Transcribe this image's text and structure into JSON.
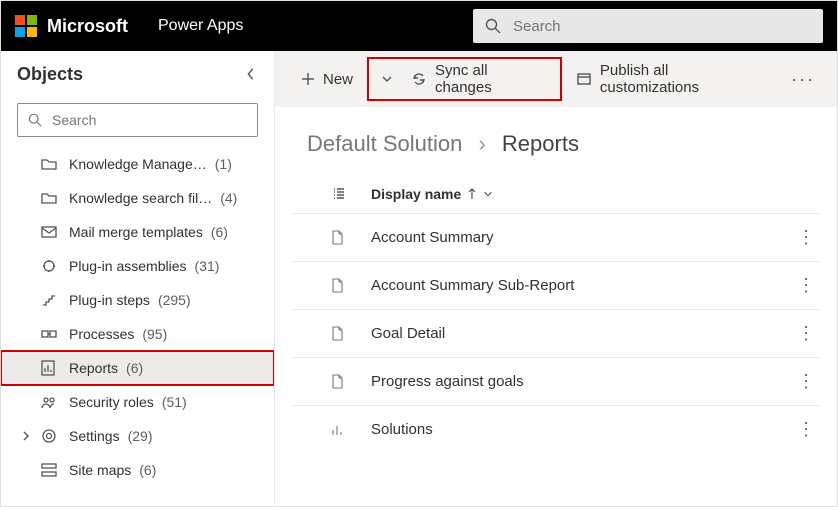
{
  "header": {
    "brand": "Microsoft",
    "app": "Power Apps",
    "search_placeholder": "Search"
  },
  "sidebar": {
    "title": "Objects",
    "search_placeholder": "Search",
    "items": [
      {
        "label": "Knowledge Manage…",
        "count": "(1)",
        "icon": "folder",
        "selected": false,
        "expandable": false
      },
      {
        "label": "Knowledge search fil…",
        "count": "(4)",
        "icon": "folder",
        "selected": false,
        "expandable": false
      },
      {
        "label": "Mail merge templates",
        "count": "(6)",
        "icon": "mail",
        "selected": false,
        "expandable": false
      },
      {
        "label": "Plug-in assemblies",
        "count": "(31)",
        "icon": "plugin",
        "selected": false,
        "expandable": false
      },
      {
        "label": "Plug-in steps",
        "count": "(295)",
        "icon": "steps",
        "selected": false,
        "expandable": false
      },
      {
        "label": "Processes",
        "count": "(95)",
        "icon": "process",
        "selected": false,
        "expandable": false
      },
      {
        "label": "Reports",
        "count": "(6)",
        "icon": "report",
        "selected": true,
        "expandable": false
      },
      {
        "label": "Security roles",
        "count": "(51)",
        "icon": "roles",
        "selected": false,
        "expandable": false
      },
      {
        "label": "Settings",
        "count": "(29)",
        "icon": "settings",
        "selected": false,
        "expandable": true
      },
      {
        "label": "Site maps",
        "count": "(6)",
        "icon": "sitemap",
        "selected": false,
        "expandable": false
      }
    ]
  },
  "commandbar": {
    "new_label": "New",
    "sync_label": "Sync all changes",
    "publish_label": "Publish all customizations"
  },
  "breadcrumb": {
    "root": "Default Solution",
    "current": "Reports"
  },
  "grid": {
    "header": "Display name",
    "rows": [
      {
        "name": "Account Summary",
        "icon": "doc"
      },
      {
        "name": "Account Summary Sub-Report",
        "icon": "doc"
      },
      {
        "name": "Goal Detail",
        "icon": "doc"
      },
      {
        "name": "Progress against goals",
        "icon": "doc"
      },
      {
        "name": "Solutions",
        "icon": "chart"
      }
    ]
  }
}
